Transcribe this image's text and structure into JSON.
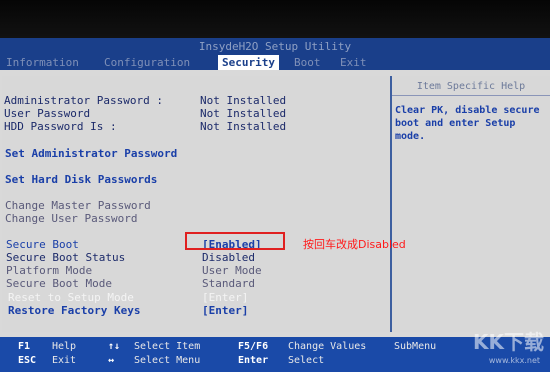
{
  "bios": {
    "title": "InsydeH2O Setup Utility",
    "tabs": [
      {
        "label": "Information"
      },
      {
        "label": "Configuration"
      },
      {
        "label": "Security"
      },
      {
        "label": "Boot"
      },
      {
        "label": "Exit"
      }
    ],
    "active_tab": "Security"
  },
  "security": {
    "admin_password": {
      "label": "Administrator Password :",
      "value": "Not Installed"
    },
    "user_password": {
      "label": "User Password",
      "value": "Not Installed"
    },
    "hdd_password": {
      "label": "HDD Password Is :",
      "value": "Not Installed"
    },
    "set_admin_password": "Set Administrator Password",
    "set_hdd_passwords": "Set Hard Disk Passwords",
    "change_master_password": "Change Master Password",
    "change_user_password": "Change User Password",
    "secure_boot": {
      "label": "Secure Boot",
      "value": "[Enabled]"
    },
    "secure_boot_status": {
      "label": "Secure Boot Status",
      "value": "Disabled"
    },
    "platform_mode": {
      "label": "Platform Mode",
      "value": "User Mode"
    },
    "secure_boot_mode": {
      "label": "Secure Boot Mode",
      "value": "Standard"
    },
    "reset_setup_mode": {
      "label": "Reset to Setup Mode",
      "value": "[Enter]"
    },
    "restore_factory_keys": {
      "label": "Restore Factory Keys",
      "value": "[Enter]"
    }
  },
  "help": {
    "title": "Item Specific Help",
    "text": "Clear PK, disable secure boot and enter Setup mode."
  },
  "annotation": {
    "text": "按回车改成Disabled",
    "color": "#ff1a1a"
  },
  "footer": {
    "keys": [
      {
        "key": "F1",
        "action": "Help"
      },
      {
        "key": "ESC",
        "action": "Exit"
      },
      {
        "key": "↑↓",
        "action": "Select Item"
      },
      {
        "key": "↔",
        "action": "Select Menu"
      },
      {
        "key": "F5/F6",
        "action": "Change Values"
      },
      {
        "key": "Enter",
        "action": "Select"
      },
      {
        "key": "",
        "action": "SubMenu"
      }
    ]
  },
  "watermark": {
    "logo": "KK下载",
    "url": "www.kkx.net"
  },
  "colors": {
    "bios_blue": "#1a3f8a",
    "panel_gray": "#d8d8d8",
    "link_blue": "#1a3fa8",
    "annotation_red": "#e02020"
  }
}
